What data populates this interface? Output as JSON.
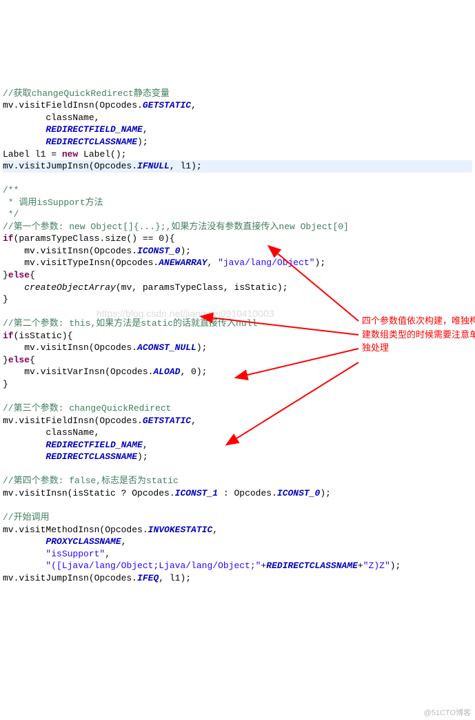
{
  "code": {
    "l1_cm": "//获取changeQuickRedirect静态变量",
    "l2a": "mv.visitFieldInsn(Opcodes.",
    "l2b": "GETSTATIC",
    "l2c": ",",
    "l3": "        className,",
    "l4a": "        ",
    "l4b": "REDIRECTFIELD_NAME",
    "l4c": ",",
    "l5a": "        ",
    "l5b": "REDIRECTCLASSNAME",
    "l5c": ");",
    "l6a": "Label l1 = ",
    "l6b": "new",
    "l6c": " Label();",
    "l7a": "mv.visitJumpInsn(Opcodes.",
    "l7b": "IFNULL",
    "l7c": ", l1);",
    "l9a": "/**",
    "l9b": " * 调用isSupport方法",
    "l9c": " */",
    "l10": "//第一个参数: new Object[]{...};,如果方法没有参数直接传入new Object[0]",
    "l11a": "if",
    "l11b": "(paramsTypeClass.size() == 0){",
    "l12a": "    mv.visitInsn(Opcodes.",
    "l12b": "ICONST_0",
    "l12c": ");",
    "l13a": "    mv.visitTypeInsn(Opcodes.",
    "l13b": "ANEWARRAY",
    "l13c": ", ",
    "l13d": "\"java/lang/Object\"",
    "l13e": ");",
    "l14a": "}",
    "l14b": "else",
    "l14c": "{",
    "l15a": "    ",
    "l15b": "createObjectArray",
    "l15c": "(mv, paramsTypeClass, isStatic);",
    "l16": "}",
    "l18": "//第二个参数: this,如果方法是static的话就直接传入null",
    "l19a": "if",
    "l19b": "(isStatic){",
    "l20a": "    mv.visitInsn(Opcodes.",
    "l20b": "ACONST_NULL",
    "l20c": ");",
    "l21a": "}",
    "l21b": "else",
    "l21c": "{",
    "l22a": "    mv.visitVarInsn(Opcodes.",
    "l22b": "ALOAD",
    "l22c": ", 0);",
    "l23": "}",
    "l25": "//第三个参数: changeQuickRedirect",
    "l26a": "mv.visitFieldInsn(Opcodes.",
    "l26b": "GETSTATIC",
    "l26c": ",",
    "l27": "        className,",
    "l28a": "        ",
    "l28b": "REDIRECTFIELD_NAME",
    "l28c": ",",
    "l29a": "        ",
    "l29b": "REDIRECTCLASSNAME",
    "l29c": ");",
    "l31": "//第四个参数: false,标志是否为static",
    "l32a": "mv.visitInsn(isStatic ? Opcodes.",
    "l32b": "ICONST_1",
    "l32c": " : Opcodes.",
    "l32d": "ICONST_0",
    "l32e": ");",
    "l34": "//开始调用",
    "l35a": "mv.visitMethodInsn(Opcodes.",
    "l35b": "INVOKESTATIC",
    "l35c": ",",
    "l36a": "        ",
    "l36b": "PROXYCLASSNAME",
    "l36c": ",",
    "l37a": "        ",
    "l37b": "\"isSupport\"",
    "l37c": ",",
    "l38a": "        ",
    "l38b": "\"([Ljava/lang/Object;Ljava/lang/Object;\"",
    "l38c": "+",
    "l38d": "REDIRECTCLASSNAME",
    "l38e": "+",
    "l38f": "\"Z)Z\"",
    "l38g": ");",
    "l39a": "mv.visitJumpInsn(Opcodes.",
    "l39b": "IFEQ",
    "l39c": ", l1);"
  },
  "annotation": "四个参数值依次构建，唯独构建数组类型的时候需要注意单独处理",
  "watermark": "https://blog.csdn.net/jiangwei0910410003",
  "footer": "@51CTO博客"
}
